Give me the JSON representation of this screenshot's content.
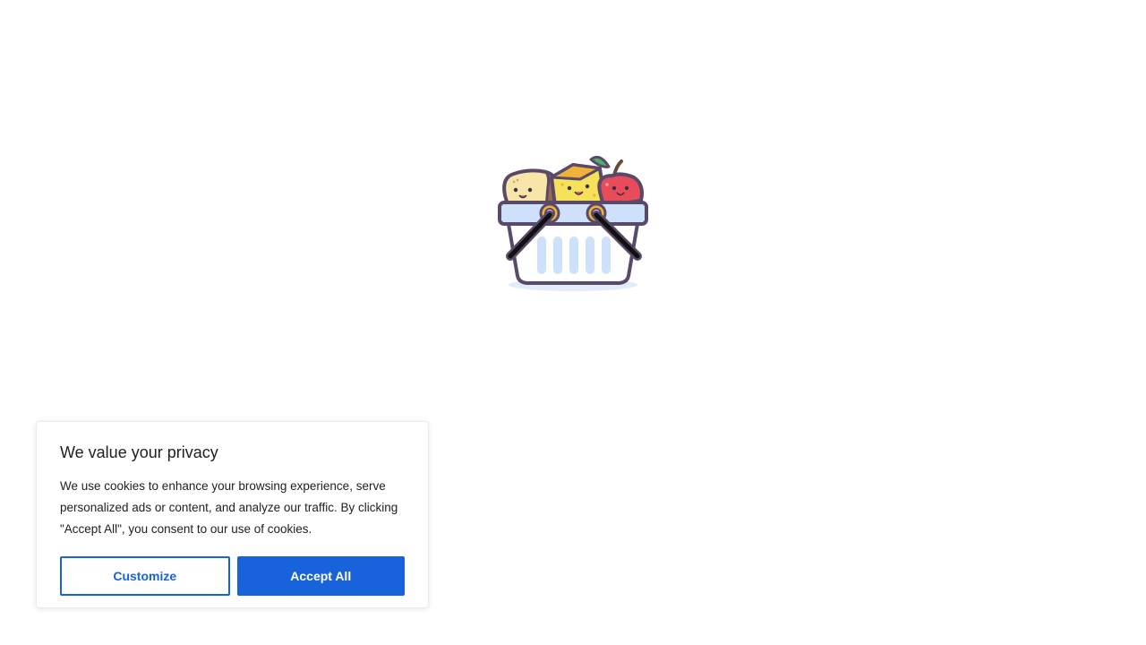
{
  "loader": {
    "illustration": "grocery-basket-icon"
  },
  "cookie_banner": {
    "title": "We value your privacy",
    "text": "We use cookies to enhance your browsing experience, serve personalized ads or content, and analyze our traffic. By clicking \"Accept All\", you consent to our use of cookies.",
    "customize_label": "Customize",
    "accept_label": "Accept All",
    "accent_color": "#1863dc"
  }
}
